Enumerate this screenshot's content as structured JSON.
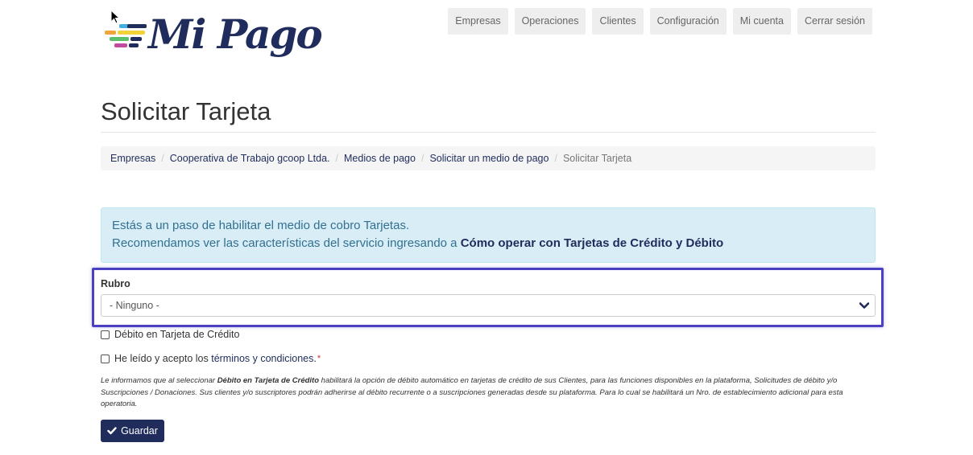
{
  "logo": {
    "text": "Mi Pago"
  },
  "nav": {
    "items": [
      "Empresas",
      "Operaciones",
      "Clientes",
      "Configuración",
      "Mi cuenta",
      "Cerrar sesión"
    ]
  },
  "page": {
    "title": "Solicitar Tarjeta"
  },
  "breadcrumb": {
    "items": [
      "Empresas",
      "Cooperativa de Trabajo gcoop Ltda.",
      "Medios de pago",
      "Solicitar un medio de pago"
    ],
    "current": "Solicitar Tarjeta"
  },
  "alert": {
    "line1": "Estás a un paso de habilitar el medio de cobro Tarjetas.",
    "line2_prefix": "Recomendamos ver las características del servicio ingresando a ",
    "line2_link": "Cómo operar con Tarjetas de Crédito y Débito"
  },
  "form": {
    "rubro_label": "Rubro",
    "rubro_selected": "- Ninguno -",
    "debito_label": "Débito en Tarjeta de Crédito",
    "terms_prefix": "He leído y acepto los ",
    "terms_link": "términos y condiciones.",
    "required_mark": "*",
    "note_prefix": "Le informamos que al seleccionar ",
    "note_bold": "Débito en Tarjeta de Crédito",
    "note_suffix": " habilitará la opción de débito automático en tarjetas de crédito de sus Clientes, para las funciones disponibles en la plataforma, Solicitudes de débito y/o Suscripciones / Donaciones. Sus clientes y/o suscriptores podrán adherirse al débito recurrente o a suscripciones generadas desde su plataforma. Para lo cual se habilitará un Nro. de establecimiento adicional para esta operatoria.",
    "save_label": "Guardar"
  },
  "colors": {
    "brand": "#1f2c5c",
    "highlight": "#4b3fc2",
    "alert_bg": "#d9edf7"
  }
}
